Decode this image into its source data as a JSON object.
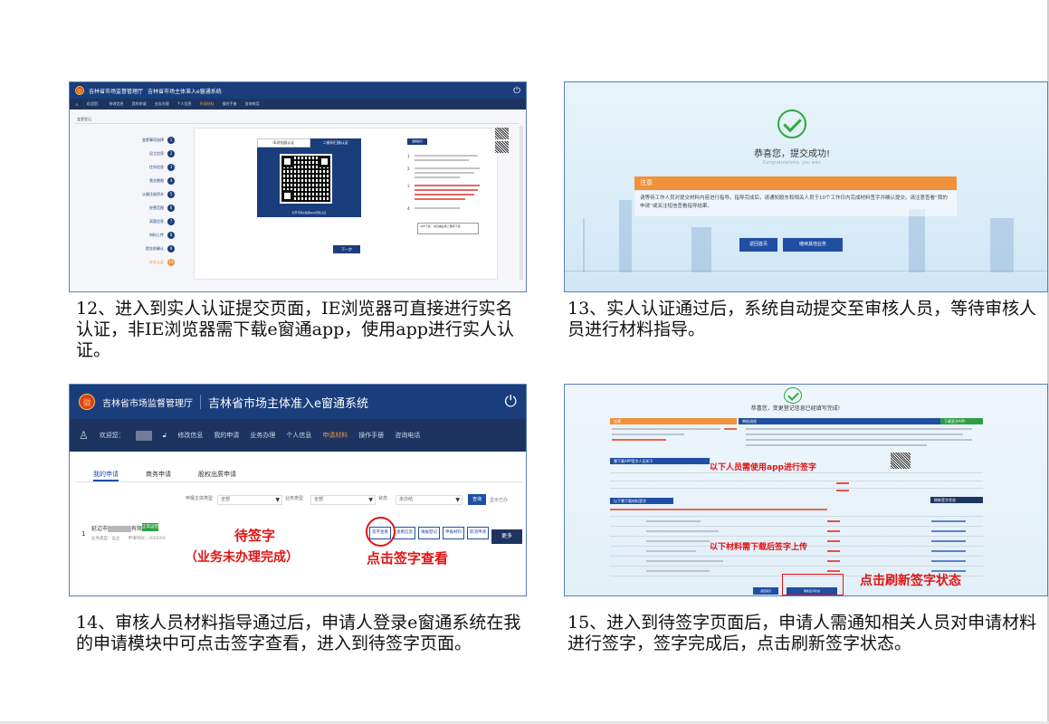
{
  "captions": {
    "c12": "12、进入到实人认证提交页面，IE浏览器可直接进行实名认证，非IE浏览器需下载e窗通app，使用app进行实人认证。",
    "c13": "13、实人认证通过后，系统自动提交至审核人员，等待审核人员进行材料指导。",
    "c14": "14、审核人员材料指导通过后，申请人登录e窗通系统在我的申请模块中可点击签字查看，进入到待签字页面。",
    "c15": "15、进入到待签字页面后，申请人需通知相关人员对申请材料进行签字，签字完成后，点击刷新签字状态。"
  },
  "header": {
    "emblem": "徽",
    "agency": "吉林省市场监督管理厅",
    "system": "吉林省市场主体准入e窗通系统",
    "power_icon": "power-icon"
  },
  "nav": {
    "welcome": "欢迎您：",
    "edit_info": "修改信息",
    "items": [
      "我的申请",
      "业务办理",
      "个人信息",
      "申请材料",
      "操作手册",
      "咨询电话"
    ],
    "active_index": 3
  },
  "p12": {
    "crumb": "变更登记",
    "steps": [
      {
        "label": "变更事项选择",
        "n": "1"
      },
      {
        "label": "设立信息",
        "n": "2"
      },
      {
        "label": "住所信息",
        "n": "3"
      },
      {
        "label": "营业期限",
        "n": "4"
      },
      {
        "label": "认缴注册资本",
        "n": "5"
      },
      {
        "label": "经营范围",
        "n": "6"
      },
      {
        "label": "高管信息",
        "n": "7"
      },
      {
        "label": "材料上传",
        "n": "8"
      },
      {
        "label": "提交前确认",
        "n": "9"
      },
      {
        "label": "实名认证",
        "n": "10"
      }
    ],
    "qr_tabs": [
      "IE浏览器认证",
      "二维码扫描认证"
    ],
    "qr_caption": "打开手机e窗通app扫码认证",
    "next": "下一步",
    "tips_title": "温馨提示",
    "tips_box": "APP下载：请扫描右侧二维码下载"
  },
  "p13": {
    "congrats": "恭喜您，提交成功!",
    "congrats_en": "Congratulations, you win!",
    "note_title": "注意",
    "note_text": "请等待工作人员对提交材料内容进行指导。指导完成后，请通知股东和相关人员于10个工作日内完成材料签字并确认提交。请注意查看“我的申请”或关注短信查看指导结果。",
    "btn_home": "返回首页",
    "btn_continue": "继续其他业务"
  },
  "p14": {
    "tabs": [
      "我的申请",
      "商务申请",
      "股权出质申请"
    ],
    "filters": {
      "type_label": "申报主体类型",
      "type_value": "全部",
      "biz_label": "业务类型",
      "biz_value": "全部",
      "status_label": "状态",
      "status_value": "未办结",
      "query": "查询",
      "expand": "显示已办"
    },
    "row": {
      "index": "1",
      "company_pre": "延边市",
      "company_post": "有限公司",
      "badge": "正常运营",
      "meta": "业务类型：设立　　申请时间：2020/03"
    },
    "actions": [
      "签字查看",
      "查看信息",
      "填报登记",
      "申报材料",
      "取消申请"
    ],
    "more": "更多",
    "annot_pending": "待签字",
    "annot_unfinished": "（业务未办理完成）",
    "annot_click": "点击签字查看"
  },
  "p15": {
    "title": "恭喜您，变更登记信息已经填写完成!",
    "bar_note": "注意",
    "bar_flow": "审核流程",
    "download_btn": "下载签字APP",
    "bar_app": "需下载APP签字人员如下",
    "bar_upload": "以下需下载材料签字",
    "refresh_btn": "刷新签字状态",
    "back_btn": "返回首页",
    "annot_app": "以下人员需使用app进行签字",
    "annot_upload": "以下材料需下载后签字上传",
    "annot_refresh": "点击刷新签字状态"
  },
  "colors": {
    "navy": "#1a3d7c",
    "orange": "#f0923a",
    "annotation_red": "#e01414",
    "success_green": "#2eaa3c"
  }
}
